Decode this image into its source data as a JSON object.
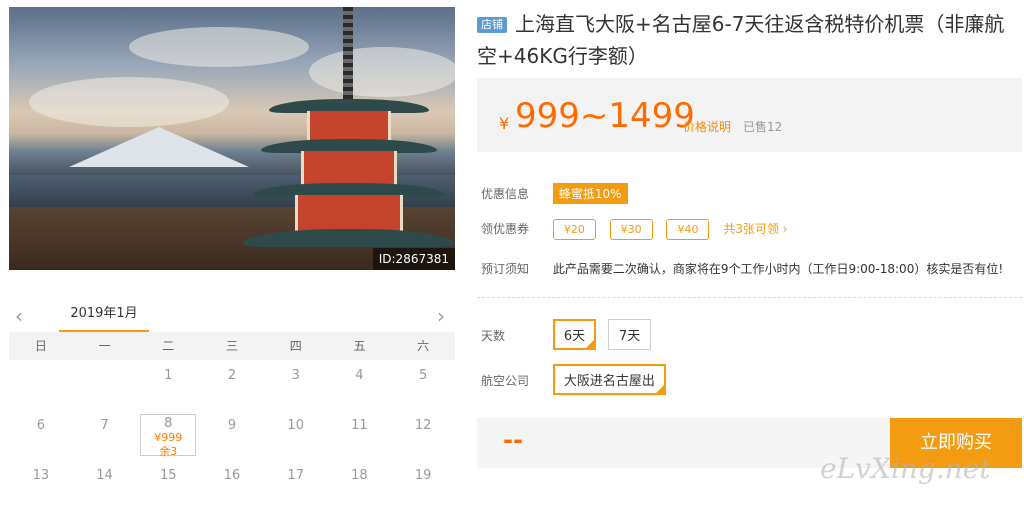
{
  "product": {
    "image_id": "ID:2867381",
    "badge": "店铺",
    "title": "上海直飞大阪+名古屋6-7天往返含税特价机票（非廉航空+46KG行李额）"
  },
  "price": {
    "currency": "¥",
    "range": "999~1499",
    "note": "价格说明",
    "sold": "已售12"
  },
  "promo": {
    "label": "优惠信息",
    "tag": "蜂蜜抵10%"
  },
  "coupons": {
    "label": "领优惠券",
    "items": [
      "¥20",
      "¥30",
      "¥40"
    ],
    "link": "共3张可领 ›"
  },
  "notice": {
    "label": "预订须知",
    "text": "此产品需要二次确认，商家将在9个工作小时内（工作日9:00-18:00）核实是否有位!"
  },
  "days": {
    "label": "天数",
    "options": [
      "6天",
      "7天"
    ]
  },
  "airline": {
    "label": "航空公司",
    "options": [
      "大阪进名古屋出"
    ]
  },
  "buy": {
    "total": "--",
    "button": "立即购买"
  },
  "calendar": {
    "month": "2019年1月",
    "prev": "‹",
    "next": "›",
    "weekdays": [
      "日",
      "一",
      "二",
      "三",
      "四",
      "五",
      "六"
    ],
    "row1": [
      "",
      "",
      "1",
      "2",
      "3",
      "4",
      "5"
    ],
    "row2": [
      "6",
      "7",
      "8",
      "9",
      "10",
      "11",
      "12"
    ],
    "row3": [
      "13",
      "14",
      "15",
      "16",
      "17",
      "18",
      "19"
    ],
    "selected": {
      "price": "¥999",
      "stock": "余3"
    }
  },
  "watermark": "eLvXing.net"
}
